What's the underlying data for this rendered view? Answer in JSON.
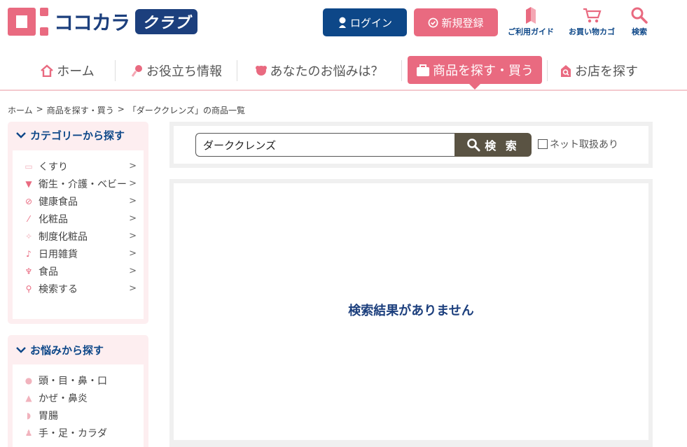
{
  "header": {
    "logo_text": "ココカラ",
    "logo_badge": "クラブ",
    "login_label": "ログイン",
    "register_label": "新規登録",
    "links": [
      {
        "label": "ご利用ガイド",
        "icon": "guide-icon"
      },
      {
        "label": "お買い物カゴ",
        "icon": "cart-icon"
      },
      {
        "label": "検索",
        "icon": "search-icon"
      }
    ]
  },
  "nav": {
    "items": [
      {
        "label": "ホーム",
        "icon": "home-icon"
      },
      {
        "label": "お役立ち情報",
        "icon": "info-icon"
      },
      {
        "label": "あなたのお悩みは？",
        "icon": "worry-icon"
      },
      {
        "label": "商品を探す・買う",
        "icon": "bag-icon",
        "active": true
      },
      {
        "label": "お店を探す",
        "icon": "store-icon"
      }
    ]
  },
  "breadcrumb": {
    "items": [
      "ホーム",
      "商品を探す・買う",
      "「ダーククレンズ」の商品一覧"
    ],
    "separator": ">"
  },
  "sidebar": {
    "category_title": "カテゴリーから探す",
    "categories": [
      {
        "label": "くすり",
        "icon": "medicine-box-icon"
      },
      {
        "label": "衛生・介護・ベビー",
        "icon": "diaper-icon"
      },
      {
        "label": "健康食品",
        "icon": "supplement-icon"
      },
      {
        "label": "化粧品",
        "icon": "cosmetics-icon"
      },
      {
        "label": "制度化粧品",
        "icon": "premium-cosmetics-icon"
      },
      {
        "label": "日用雑貨",
        "icon": "household-icon"
      },
      {
        "label": "食品",
        "icon": "food-icon"
      },
      {
        "label": "検索する",
        "icon": "search-icon"
      }
    ],
    "worry_title": "お悩みから探す",
    "worries": [
      {
        "label": "頭・目・鼻・口",
        "icon": "head-icon"
      },
      {
        "label": "かぜ・鼻炎",
        "icon": "cold-icon"
      },
      {
        "label": "胃腸",
        "icon": "stomach-icon"
      },
      {
        "label": "手・足・カラダ",
        "icon": "body-icon"
      }
    ]
  },
  "search": {
    "value": "ダーククレンズ",
    "button_label": "検 索",
    "net_checkbox_label": "ネット取扱あり"
  },
  "result": {
    "message": "検索結果がありません"
  },
  "colors": {
    "brand_pink": "#e96a80",
    "brand_navy": "#0d4788",
    "search_button": "#5a5343"
  }
}
